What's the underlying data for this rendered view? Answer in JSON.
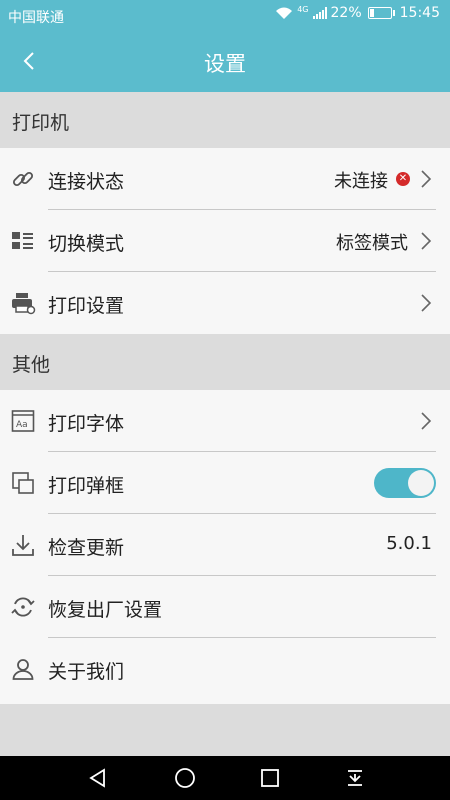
{
  "status_bar": {
    "carrier": "中国联通",
    "network": "4G",
    "battery": "22%",
    "battery_level": 0.22,
    "time": "15:45"
  },
  "header": {
    "title": "设置"
  },
  "sections": {
    "printer": "打印机",
    "other": "其他"
  },
  "rows": {
    "connection": {
      "label": "连接状态",
      "value": "未连接",
      "status_icon": "error-icon"
    },
    "mode": {
      "label": "切换模式",
      "value": "标签模式"
    },
    "print_settings": {
      "label": "打印设置"
    },
    "font": {
      "label": "打印字体"
    },
    "dialog": {
      "label": "打印弹框",
      "toggle_on": true
    },
    "update": {
      "label": "检查更新",
      "value": "5.0.1"
    },
    "reset": {
      "label": "恢复出厂设置"
    },
    "about": {
      "label": "关于我们"
    }
  },
  "colors": {
    "accent": "#5bbccd",
    "toggle": "#4eb6c9",
    "error": "#d42a2a",
    "background": "#dcdcdc",
    "row": "#f7f7f7"
  },
  "navbar": [
    "back-icon",
    "home-icon",
    "recents-icon",
    "notification-icon"
  ]
}
